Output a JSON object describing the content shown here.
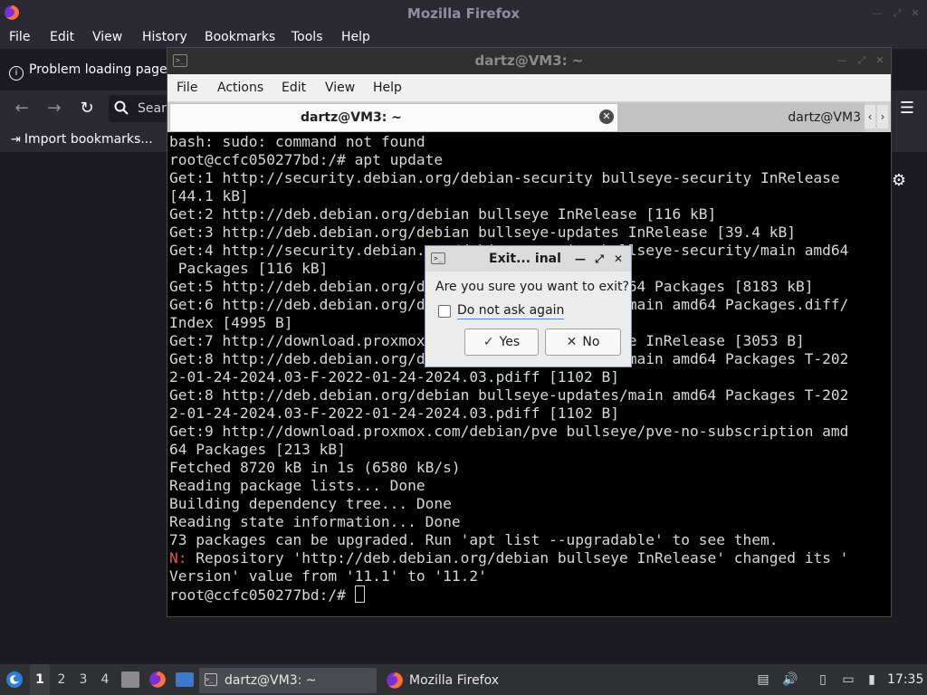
{
  "firefox": {
    "window_title": "Mozilla Firefox",
    "menu": [
      "File",
      "Edit",
      "View",
      "History",
      "Bookmarks",
      "Tools",
      "Help"
    ],
    "tab_label": "Problem loading page",
    "search_placeholder": "Sear",
    "bookmark_import": "Import bookmarks...",
    "menu_glyph": "☰",
    "settings_glyph": "⚙"
  },
  "terminal": {
    "window_title": "dartz@VM3: ~",
    "menu": [
      "File",
      "Actions",
      "Edit",
      "View",
      "Help"
    ],
    "tabs": [
      {
        "label": "dartz@VM3: ~",
        "active": true
      },
      {
        "label": "dartz@VM3",
        "active": false
      }
    ],
    "lines": [
      "bash: sudo: command not found",
      "root@ccfc050277bd:/# apt update",
      "Get:1 http://security.debian.org/debian-security bullseye-security InRelease",
      "[44.1 kB]",
      "Get:2 http://deb.debian.org/debian bullseye InRelease [116 kB]",
      "Get:3 http://deb.debian.org/debian bullseye-updates InRelease [39.4 kB]",
      "Get:4 http://security.debian.org/debian-security bullseye-security/main amd64",
      " Packages [116 kB]",
      "Get:5 http://deb.debian.org/debian bullseye/main amd64 Packages [8183 kB]",
      "Get:6 http://deb.debian.org/debian bullseye-updates/main amd64 Packages.diff/",
      "Index [4995 B]",
      "Get:7 http://download.proxmox.com/debian/pve bullseye InRelease [3053 B]",
      "Get:8 http://deb.debian.org/debian bullseye-updates/main amd64 Packages T-202",
      "2-01-24-2024.03-F-2022-01-24-2024.03.pdiff [1102 B]",
      "Get:8 http://deb.debian.org/debian bullseye-updates/main amd64 Packages T-202",
      "2-01-24-2024.03-F-2022-01-24-2024.03.pdiff [1102 B]",
      "Get:9 http://download.proxmox.com/debian/pve bullseye/pve-no-subscription amd",
      "64 Packages [213 kB]",
      "Fetched 8720 kB in 1s (6580 kB/s)",
      "Reading package lists... Done",
      "Building dependency tree... Done",
      "Reading state information... Done",
      "73 packages can be upgraded. Run 'apt list --upgradable' to see them."
    ],
    "notice_prefix": "N:",
    "notice_text": " Repository 'http://deb.debian.org/debian bullseye InRelease' changed its '",
    "notice_cont": "Version' value from '11.1' to '11.2'",
    "prompt": "root@ccfc050277bd:/# "
  },
  "dialog": {
    "title": "Exit... inal",
    "question": "Are you sure you want to exit?",
    "checkbox_label": "Do not ask again",
    "yes_label": "Yes",
    "no_label": "No"
  },
  "taskbar": {
    "workspaces": [
      "1",
      "2",
      "3",
      "4"
    ],
    "tasks": [
      "dartz@VM3: ~",
      "Mozilla Firefox"
    ],
    "clock": "17:35"
  },
  "colors": {
    "notice": "#e0584d",
    "accent": "#4a89dc"
  }
}
